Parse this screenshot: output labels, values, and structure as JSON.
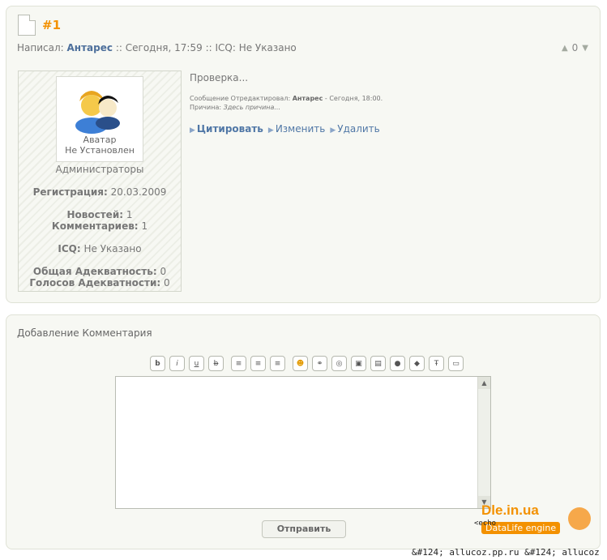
{
  "comment": {
    "number": "#1",
    "meta_prefix": "Написал:",
    "author": "Антарес",
    "meta_sep1": "::",
    "date": "Сегодня, 17:59",
    "meta_sep2": "::",
    "icq_meta": "ICQ: Не Указано",
    "rating": "0",
    "text": "Проверка...",
    "edit_prefix": "Сообщение Отредактировал:",
    "edit_author": "Антарес",
    "edit_date": "- Сегодня, 18:00.",
    "edit_reason_label": "Причина:",
    "edit_reason": "Здесь причина...",
    "actions": {
      "quote": "Цитировать",
      "edit": "Изменить",
      "delete": "Удалить"
    }
  },
  "profile": {
    "avatar_line1": "Аватар",
    "avatar_line2": "Не Установлен",
    "group": "Администраторы",
    "reg_label": "Регистрация:",
    "reg_value": "20.03.2009",
    "news_label": "Новостей:",
    "news_value": "1",
    "comments_label": "Комментариев:",
    "comments_value": "1",
    "icq_label": "ICQ:",
    "icq_value": "Не Указано",
    "adequacy_label": "Общая Адекватность:",
    "adequacy_value": "0",
    "votes_label": "Голосов Адекватности:",
    "votes_value": "0"
  },
  "add_comment": {
    "title": "Добавление Комментария",
    "submit": "Отправить",
    "toolbar": [
      "bold-icon",
      "italic-icon",
      "underline-icon",
      "strike-icon",
      "align-left-icon",
      "align-center-icon",
      "align-right-icon",
      "smile-icon",
      "link-icon",
      "leech-icon",
      "image-icon",
      "email-icon",
      "hide-icon",
      "quote-icon",
      "translit-icon",
      "spoiler-icon"
    ],
    "toolbar_glyphs": [
      "b",
      "i",
      "u",
      "b",
      "≡",
      "≡",
      "≡",
      "☻",
      "⚭",
      "◎",
      "▣",
      "▤",
      "●",
      "◆",
      "Ŧ",
      "▭"
    ]
  },
  "watermark": {
    "brand": "Dle.in.ua",
    "tag": "DataLife engine",
    "side_code": "<echo",
    "footer_text": "&#124; allucoz.pp.ru &#124; allucoz"
  },
  "colors": {
    "accent": "#f39100",
    "link": "#5077a6",
    "panel": "#f7f8f3"
  }
}
